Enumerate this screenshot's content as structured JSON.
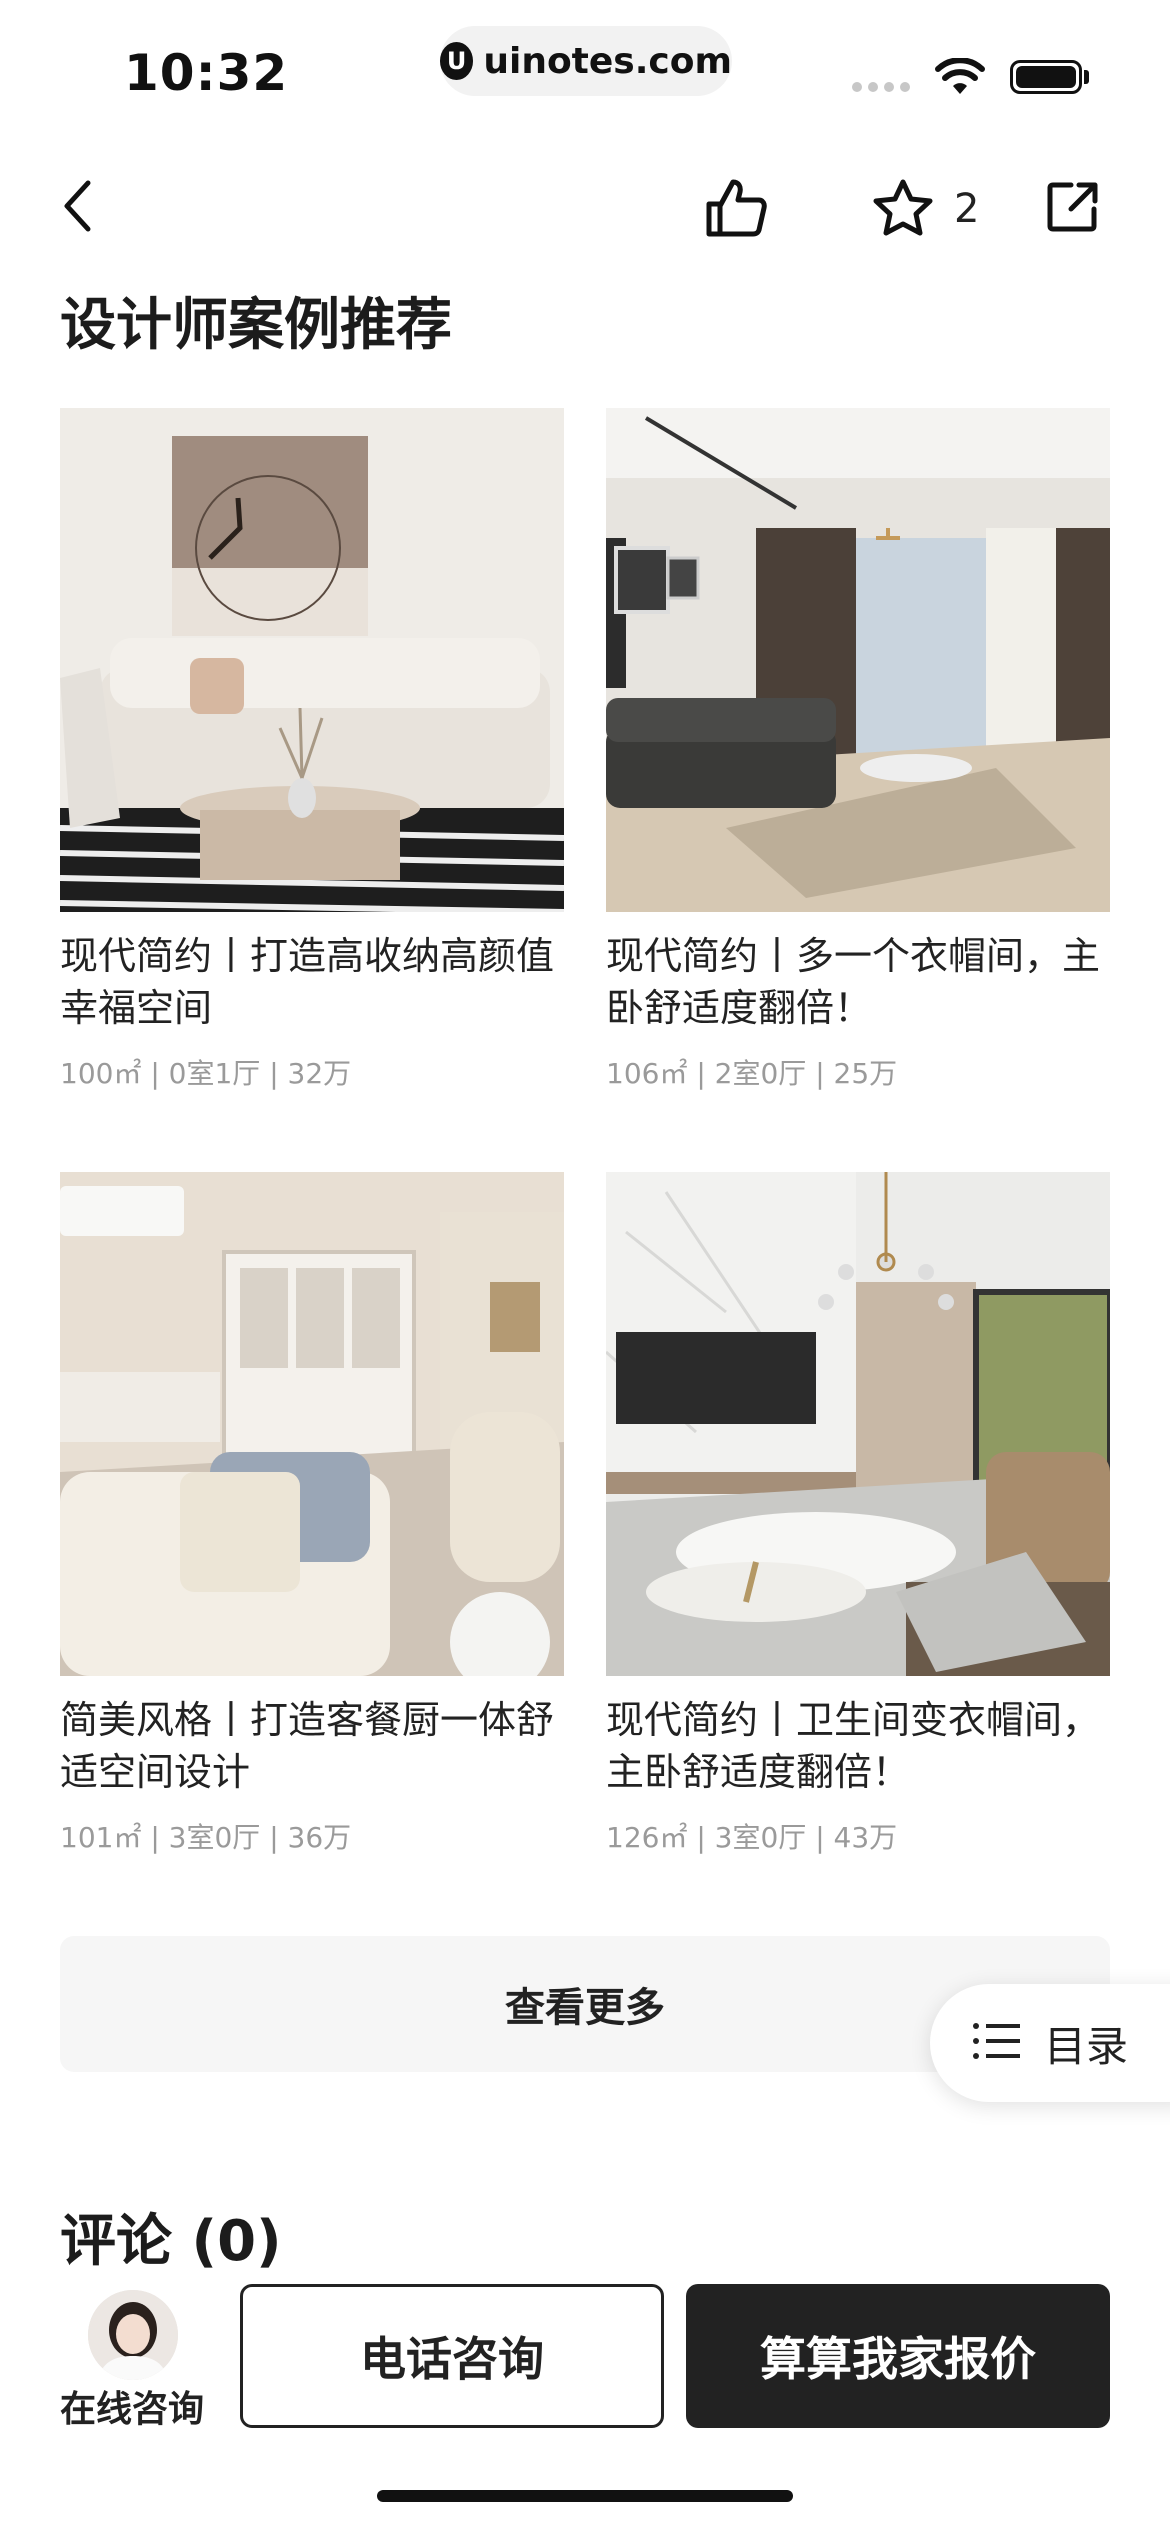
{
  "status_bar": {
    "time": "10:32",
    "url": "uinotes.com",
    "url_logo": "U"
  },
  "nav": {
    "favorite_count": "2",
    "icons": [
      "back-icon",
      "like-icon",
      "star-icon",
      "share-icon"
    ]
  },
  "section": {
    "title": "设计师案例推荐"
  },
  "cases": [
    {
      "title": "现代简约丨打造高收纳高颜值幸福空间",
      "meta": "100㎡ | 0室1厅 | 32万"
    },
    {
      "title": "现代简约丨多一个衣帽间，主卧舒适度翻倍！",
      "meta": "106㎡ | 2室0厅 | 25万"
    },
    {
      "title": "简美风格丨打造客餐厨一体舒适空间设计",
      "meta": "101㎡ | 3室0厅 | 36万"
    },
    {
      "title": "现代简约丨卫生间变衣帽间，主卧舒适度翻倍！",
      "meta": "126㎡ | 3室0厅 | 43万"
    }
  ],
  "actions": {
    "view_more": "查看更多",
    "toc": "目录"
  },
  "comments": {
    "title": "评论 (0)"
  },
  "bottom": {
    "consult_label": "在线咨询",
    "phone_label": "电话咨询",
    "quote_label": "算算我家报价"
  },
  "colors": {
    "primary_dark": "#222222",
    "muted_text": "#9a9a9a",
    "button_bg": "#f6f6f6"
  }
}
